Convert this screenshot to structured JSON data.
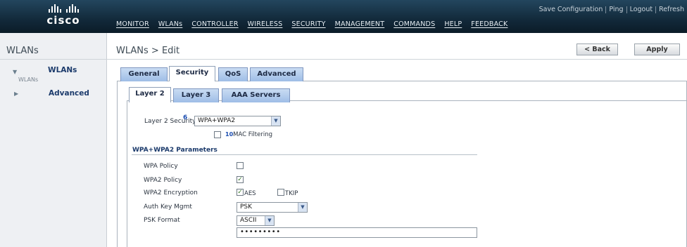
{
  "header": {
    "logo_text": "cisco",
    "utility_links": [
      "Save Configuration",
      "Ping",
      "Logout",
      "Refresh"
    ],
    "nav": [
      "MONITOR",
      "WLANs",
      "CONTROLLER",
      "WIRELESS",
      "SECURITY",
      "MANAGEMENT",
      "COMMANDS",
      "HELP",
      "FEEDBACK"
    ]
  },
  "left_panel": {
    "title": "WLANs",
    "tree": {
      "wlans_label": "WLANs",
      "wlans_sub": "WLANs",
      "advanced_label": "Advanced"
    }
  },
  "main": {
    "breadcrumb": "WLANs > Edit",
    "back_label": "< Back",
    "apply_label": "Apply",
    "tabs": [
      "General",
      "Security",
      "QoS",
      "Advanced"
    ],
    "active_tab": "Security",
    "sub_tabs": [
      "Layer 2",
      "Layer 3",
      "AAA Servers"
    ],
    "active_sub_tab": "Layer 2"
  },
  "form": {
    "layer2_security_label": "Layer 2 Security",
    "layer2_security_help": "6",
    "layer2_security_value": "WPA+WPA2",
    "mac_filtering_label": "MAC Filtering",
    "mac_filtering_marker": "10",
    "mac_filtering_checked": false,
    "params_heading": "WPA+WPA2 Parameters",
    "wpa_policy_label": "WPA Policy",
    "wpa_policy_checked": false,
    "wpa2_policy_label": "WPA2 Policy",
    "wpa2_policy_checked": true,
    "wpa2_encryption_label": "WPA2 Encryption",
    "aes_label": "AES",
    "aes_checked": true,
    "tkip_label": "TKIP",
    "tkip_checked": false,
    "auth_key_label": "Auth Key Mgmt",
    "auth_key_value": "PSK",
    "psk_format_label": "PSK Format",
    "psk_format_value": "ASCII",
    "psk_value": "•••••••••"
  }
}
